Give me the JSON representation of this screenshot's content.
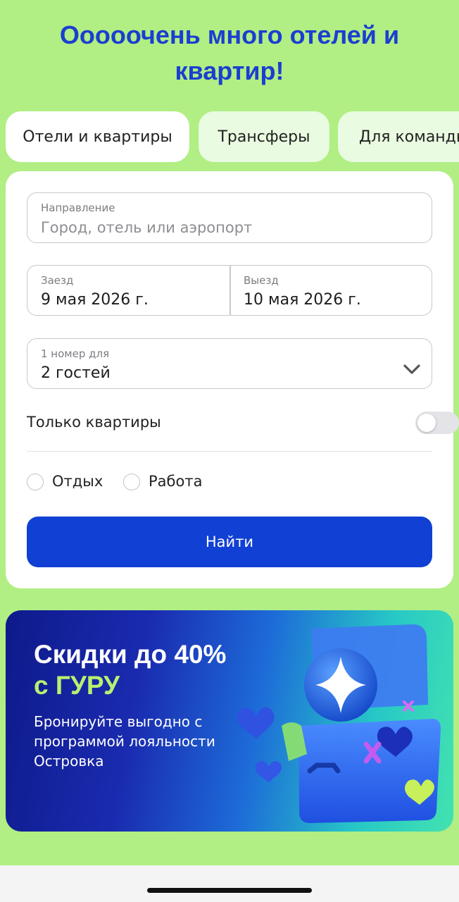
{
  "headline": "Ооооочень много отелей и квартир!",
  "tabs": [
    {
      "label": "Отели и квартиры",
      "active": true
    },
    {
      "label": "Трансферы",
      "active": false
    },
    {
      "label": "Для команды",
      "active": false
    }
  ],
  "search_form": {
    "destination": {
      "label": "Направление",
      "placeholder": "Город, отель или аэропорт"
    },
    "checkin": {
      "label": "Заезд",
      "value": "9 мая 2026 г."
    },
    "checkout": {
      "label": "Выезд",
      "value": "10 мая 2026 г."
    },
    "guests": {
      "label": "1 номер для",
      "value": "2 гостей",
      "icon": "chevron-down-icon"
    },
    "apartments_only": {
      "label": "Только квартиры",
      "enabled": false
    },
    "trip_purpose": [
      {
        "label": "Отдых",
        "selected": false
      },
      {
        "label": "Работа",
        "selected": false
      }
    ],
    "submit_label": "Найти"
  },
  "promo": {
    "title": "Скидки до 40%",
    "subtitle": "с ГУРУ",
    "text": "Бронируйте выгодно с программой лояльности Островка"
  },
  "colors": {
    "background": "#b1ee84",
    "accent": "#1040d4",
    "headline": "#1b3fd0",
    "promo_highlight": "#b9f070"
  }
}
